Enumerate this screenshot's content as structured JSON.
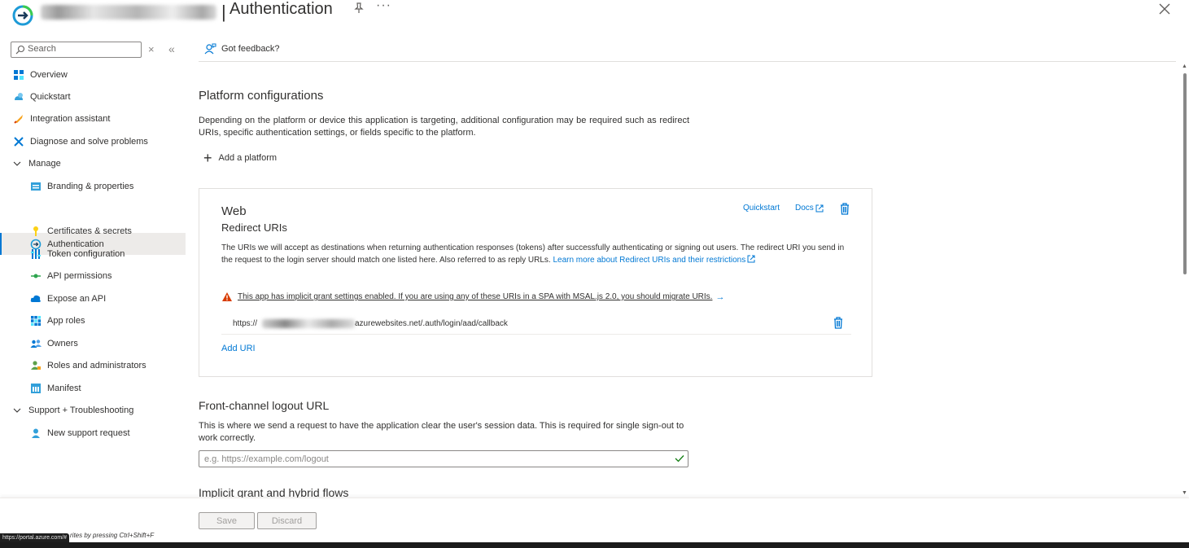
{
  "header": {
    "title": "Authentication",
    "separator": "|",
    "more": "···"
  },
  "sidebar": {
    "search_placeholder": "Search",
    "clear": "×",
    "collapse": "«",
    "items": [
      {
        "label": "Overview",
        "icon": "overview-icon"
      },
      {
        "label": "Quickstart",
        "icon": "quickstart-icon"
      },
      {
        "label": "Integration assistant",
        "icon": "rocket-icon"
      },
      {
        "label": "Diagnose and solve problems",
        "icon": "wrench-icon"
      },
      {
        "label": "Manage",
        "icon": "chevron-down-icon"
      },
      {
        "label": "Branding & properties",
        "icon": "branding-icon"
      },
      {
        "label": "Authentication",
        "icon": "authentication-icon"
      },
      {
        "label": "Certificates & secrets",
        "icon": "key-icon"
      },
      {
        "label": "Token configuration",
        "icon": "token-icon"
      },
      {
        "label": "API permissions",
        "icon": "api-permissions-icon"
      },
      {
        "label": "Expose an API",
        "icon": "cloud-icon"
      },
      {
        "label": "App roles",
        "icon": "app-roles-icon"
      },
      {
        "label": "Owners",
        "icon": "owners-icon"
      },
      {
        "label": "Roles and administrators",
        "icon": "roles-icon"
      },
      {
        "label": "Manifest",
        "icon": "manifest-icon"
      },
      {
        "label": "Support + Troubleshooting",
        "icon": "chevron-down-icon"
      },
      {
        "label": "New support request",
        "icon": "support-icon"
      }
    ]
  },
  "main": {
    "feedback": "Got feedback?",
    "platform_title": "Platform configurations",
    "platform_desc": "Depending on the platform or device this application is targeting, additional configuration may be required such as redirect URIs, specific authentication settings, or fields specific to the platform.",
    "add_platform": "Add a platform",
    "web": {
      "title": "Web",
      "redirect_title": "Redirect URIs",
      "quickstart": "Quickstart",
      "docs": "Docs",
      "desc": "The URIs we will accept as destinations when returning authentication responses (tokens) after successfully authenticating or signing out users. The redirect URI you send in the request to the login server should match one listed here. Also referred to as reply URLs.",
      "learn_more": "Learn more about Redirect URIs and their restrictions",
      "warning": "This app has implicit grant settings enabled. If you are using any of these URIs in a SPA with MSAL.js 2.0, you should migrate URIs.",
      "uri_prefix": "https://",
      "uri_suffix": "azurewebsites.net/.auth/login/aad/callback",
      "add_uri": "Add URI"
    },
    "logout_title": "Front-channel logout URL",
    "logout_desc": "This is where we send a request to have the application clear the user's session data. This is required for single sign-out to work correctly.",
    "logout_placeholder": "e.g. https://example.com/logout",
    "implicit_title": "Implicit grant and hybrid flows"
  },
  "footer": {
    "save": "Save",
    "discard": "Discard",
    "status_url": "https://portal.azure.com/#",
    "hint": "rites by pressing Ctrl+Shift+F"
  },
  "colors": {
    "accent": "#0078d4",
    "warning": "#d83b01",
    "active_bg": "#edebe9"
  }
}
